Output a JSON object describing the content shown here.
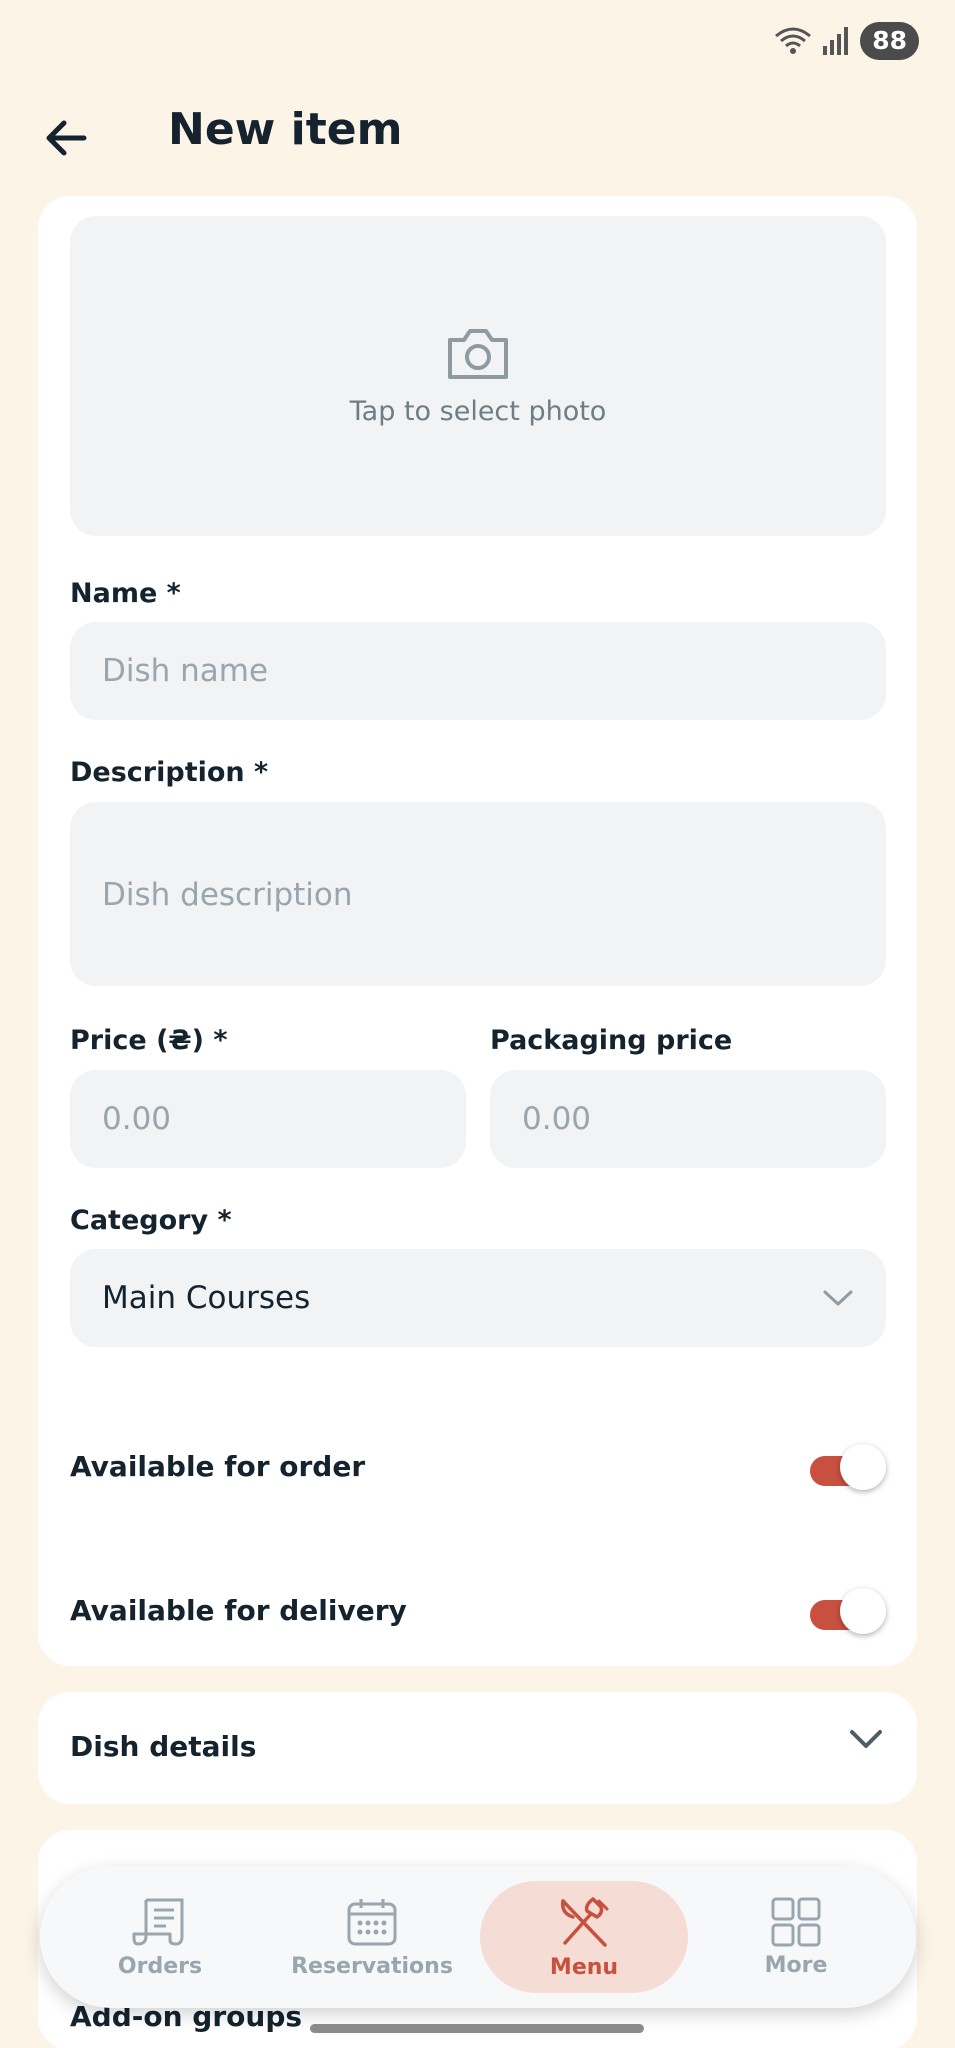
{
  "status_bar": {
    "battery": "88"
  },
  "header": {
    "title": "New item"
  },
  "photo": {
    "prompt": "Tap to select photo"
  },
  "form": {
    "name_label": "Name *",
    "name_placeholder": "Dish name",
    "description_label": "Description *",
    "description_placeholder": "Dish description",
    "price_label": "Price (₴) *",
    "price_placeholder": "0.00",
    "packaging_label": "Packaging price",
    "packaging_placeholder": "0.00",
    "category_label": "Category *",
    "category_value": "Main Courses",
    "available_order_label": "Available for order",
    "available_order_on": true,
    "available_delivery_label": "Available for delivery",
    "available_delivery_on": true
  },
  "sections": {
    "dish_details": "Dish details",
    "addon_groups": "Add-on groups"
  },
  "nav": {
    "items": [
      {
        "label": "Orders",
        "icon": "receipt-icon",
        "active": false
      },
      {
        "label": "Reservations",
        "icon": "calendar-icon",
        "active": false
      },
      {
        "label": "Menu",
        "icon": "fork-knife-icon",
        "active": true
      },
      {
        "label": "More",
        "icon": "grid-icon",
        "active": false
      }
    ]
  },
  "colors": {
    "background": "#fdf4e8",
    "accent": "#c8503f",
    "field_bg": "#f1f3f5",
    "nav_active_bg": "#f5dcd5"
  }
}
